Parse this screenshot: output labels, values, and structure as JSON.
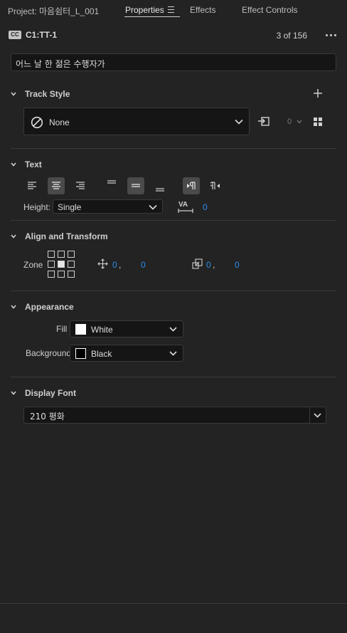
{
  "tabs": {
    "project": "Project: 마음쉼터_L_001",
    "properties": "Properties",
    "effects": "Effects",
    "effect_controls": "Effect Controls"
  },
  "clip": {
    "badge": "CC",
    "name": "C1:TT-1",
    "count": "3 of 156"
  },
  "caption_text": "어느 날 한 젊은 수행자가",
  "track_style": {
    "title": "Track Style",
    "value": "None",
    "count": "0"
  },
  "text_section": {
    "title": "Text",
    "height_label": "Height:",
    "height_value": "Single",
    "tracking_value": "0",
    "tracking_icon": "VA"
  },
  "align_transform": {
    "title": "Align and Transform",
    "zone_label": "Zone",
    "position_x": "0",
    "position_y": "0",
    "scale_x": "0",
    "scale_y": "0",
    "comma": ","
  },
  "appearance": {
    "title": "Appearance",
    "fill_label": "Fill",
    "fill_value": "White",
    "fill_color": "#ffffff",
    "background_label": "Background",
    "background_value": "Black",
    "background_color": "#000000"
  },
  "display_font": {
    "title": "Display Font",
    "value": "210 평화"
  },
  "colors": {
    "accent_value": "#2d8ceb",
    "panel_bg": "#232323"
  }
}
